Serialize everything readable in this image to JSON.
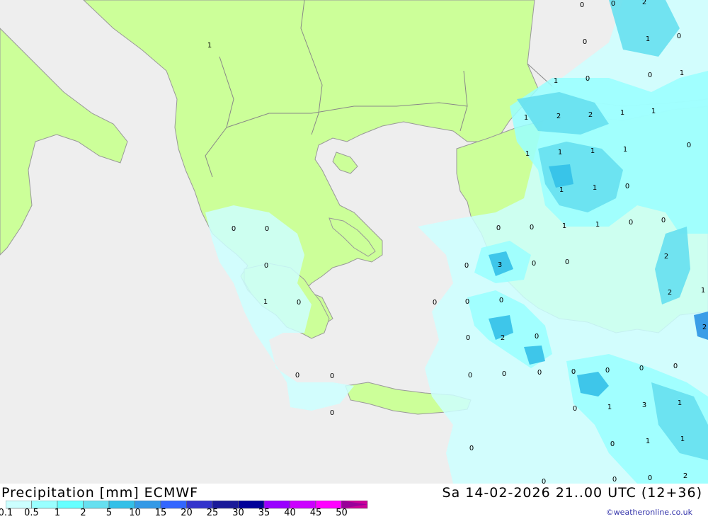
{
  "title": "Precipitation [mm] ECMWF",
  "datetime": "Sa 14-02-2026 21..00 UTC (12+36)",
  "credit": "©weatheronline.co.uk",
  "colors": {
    "sea": "#eeeeee",
    "land": "#ccff99",
    "coast": "#999999",
    "border": "#888888"
  },
  "legend": {
    "labels": [
      "0.1",
      "0.5",
      "1",
      "2",
      "5",
      "10",
      "15",
      "20",
      "25",
      "30",
      "35",
      "40",
      "45",
      "50"
    ],
    "colors": [
      "#ccffff",
      "#99ffff",
      "#66ffff",
      "#66e0f0",
      "#33c0e8",
      "#3399e6",
      "#3366ff",
      "#3333cc",
      "#1a1a99",
      "#000099",
      "#9900ff",
      "#cc00ff",
      "#ff00ff",
      "#cc0099"
    ]
  },
  "map_values": [
    "1",
    "0",
    "2",
    "3"
  ]
}
